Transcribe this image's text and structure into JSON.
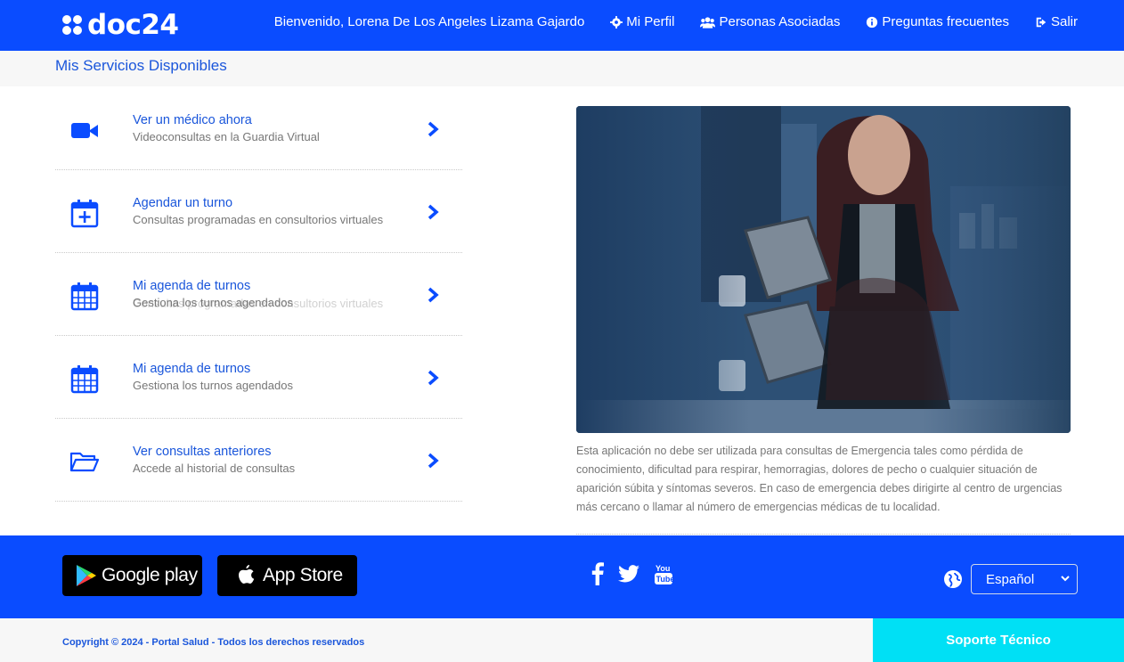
{
  "brand": {
    "logo_text": "doc24"
  },
  "nav": {
    "welcome": "Bienvenido, Lorena De Los Angeles Lizama Gajardo",
    "profile": "Mi Perfil",
    "associated": "Personas Asociadas",
    "faq": "Preguntas frecuentes",
    "logout": "Salir"
  },
  "page": {
    "title": "Mis Servicios Disponibles"
  },
  "services": [
    {
      "title": "Ver un médico ahora",
      "subtitle": "Videoconsultas en la Guardia Virtual",
      "icon": "video-camera-icon"
    },
    {
      "title": "Agendar un turno",
      "subtitle": "Consultas programadas en consultorios virtuales",
      "icon": "calendar-plus-icon"
    },
    {
      "title": "Mi agenda de turnos",
      "subtitle": "Gestiona los turnos agendados",
      "ghost_text": "Consultas programadas en consultorios virtuales",
      "icon": "calendar-grid-icon"
    },
    {
      "title": "Mi agenda de turnos",
      "subtitle": "Gestiona los turnos agendados",
      "icon": "calendar-grid-icon"
    },
    {
      "title": "Ver consultas anteriores",
      "subtitle": "Accede al historial de consultas",
      "icon": "folder-open-icon"
    }
  ],
  "disclaimer": "Esta aplicación no debe ser utilizada para consultas de Emergencia tales como pérdida de conocimiento, dificultad para respirar, hemorragias, dolores de pecho o cualquier situación de aparición súbita y síntomas severos. En caso de emergencia debes dirigirte al centro de urgencias más cercano o llamar al número de emergencias médicas de tu localidad.",
  "footer": {
    "google_play": "Google play",
    "app_store": "App Store",
    "language": "Español",
    "copyright": "Copyright © 2024 - Portal Salud - Todos los derechos reservados",
    "support": "Soporte Técnico"
  },
  "colors": {
    "primary": "#0a4cff",
    "link": "#1a56db",
    "support": "#00e0f5"
  }
}
